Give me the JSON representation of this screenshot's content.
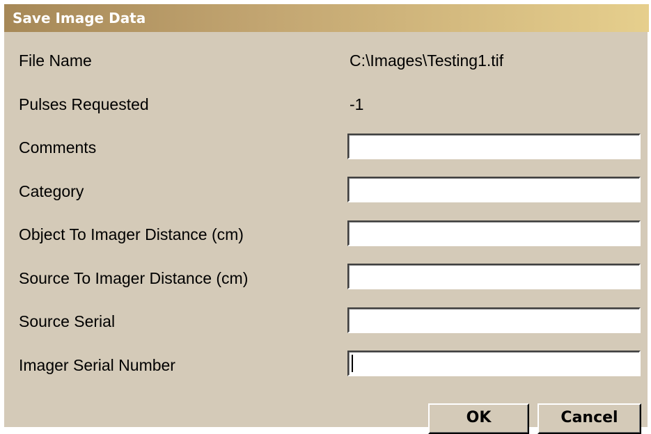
{
  "dialog": {
    "title": "Save Image Data"
  },
  "fields": {
    "file_name_label": "File Name",
    "file_name_value": "C:\\Images\\Testing1.tif",
    "pulses_label": "Pulses Requested",
    "pulses_value": "-1",
    "comments_label": "Comments",
    "comments_value": "",
    "category_label": "Category",
    "category_value": "",
    "object_distance_label": "Object To Imager Distance (cm)",
    "object_distance_value": "",
    "source_distance_label": "Source To Imager Distance (cm)",
    "source_distance_value": "",
    "source_serial_label": "Source Serial",
    "source_serial_value": "",
    "imager_serial_label": "Imager Serial Number",
    "imager_serial_value": ""
  },
  "buttons": {
    "ok_label": "OK",
    "cancel_label": "Cancel"
  },
  "colors": {
    "dialog_background": "#d4cab8",
    "title_gradient_start": "#a68857",
    "title_gradient_end": "#e6cf8d",
    "title_text": "#ffffff"
  }
}
